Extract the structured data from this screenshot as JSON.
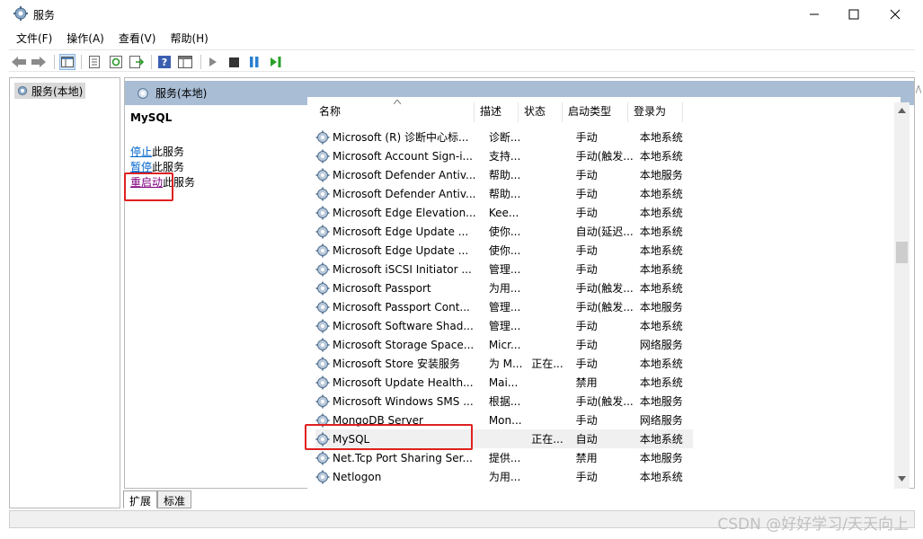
{
  "window": {
    "title": "服务"
  },
  "menu": [
    "文件(F)",
    "操作(A)",
    "查看(V)",
    "帮助(H)"
  ],
  "toolbar": {
    "icons": [
      "back-arrow-icon",
      "forward-arrow-icon",
      "show-hide-tree-icon",
      "properties-icon",
      "refresh-icon",
      "export-list-icon",
      "help-icon",
      "console-icon",
      "start-service-icon",
      "stop-service-icon",
      "pause-service-icon",
      "restart-service-icon"
    ]
  },
  "tree": {
    "node_label": "服务(本地)"
  },
  "panel": {
    "header": "服务(本地)",
    "selected_service": "MySQL",
    "actions": [
      {
        "link": "停止",
        "rest": "此服务"
      },
      {
        "link": "暂停",
        "rest": "此服务"
      },
      {
        "link": "重启动",
        "rest": "此服务"
      }
    ]
  },
  "columns": [
    "名称",
    "描述",
    "状态",
    "启动类型",
    "登录为"
  ],
  "rows": [
    {
      "name": "Microsoft (R) 诊断中心标...",
      "desc": "诊断...",
      "status": "",
      "start": "手动",
      "logon": "本地系统"
    },
    {
      "name": "Microsoft Account Sign-i...",
      "desc": "支持...",
      "status": "",
      "start": "手动(触发...",
      "logon": "本地系统"
    },
    {
      "name": "Microsoft Defender Antiv...",
      "desc": "帮助...",
      "status": "",
      "start": "手动",
      "logon": "本地服务"
    },
    {
      "name": "Microsoft Defender Antiv...",
      "desc": "帮助...",
      "status": "",
      "start": "手动",
      "logon": "本地系统"
    },
    {
      "name": "Microsoft Edge Elevation...",
      "desc": "Kee...",
      "status": "",
      "start": "手动",
      "logon": "本地系统"
    },
    {
      "name": "Microsoft Edge Update ...",
      "desc": "使你...",
      "status": "",
      "start": "自动(延迟...",
      "logon": "本地系统"
    },
    {
      "name": "Microsoft Edge Update ...",
      "desc": "使你...",
      "status": "",
      "start": "手动",
      "logon": "本地系统"
    },
    {
      "name": "Microsoft iSCSI Initiator ...",
      "desc": "管理...",
      "status": "",
      "start": "手动",
      "logon": "本地系统"
    },
    {
      "name": "Microsoft Passport",
      "desc": "为用...",
      "status": "",
      "start": "手动(触发...",
      "logon": "本地系统"
    },
    {
      "name": "Microsoft Passport Cont...",
      "desc": "管理...",
      "status": "",
      "start": "手动(触发...",
      "logon": "本地服务"
    },
    {
      "name": "Microsoft Software Shad...",
      "desc": "管理...",
      "status": "",
      "start": "手动",
      "logon": "本地系统"
    },
    {
      "name": "Microsoft Storage Space...",
      "desc": "Micr...",
      "status": "",
      "start": "手动",
      "logon": "网络服务"
    },
    {
      "name": "Microsoft Store 安装服务",
      "desc": "为 M...",
      "status": "正在...",
      "start": "手动",
      "logon": "本地系统"
    },
    {
      "name": "Microsoft Update Health...",
      "desc": "Mai...",
      "status": "",
      "start": "禁用",
      "logon": "本地系统"
    },
    {
      "name": "Microsoft Windows SMS ...",
      "desc": "根据...",
      "status": "",
      "start": "手动(触发...",
      "logon": "本地服务"
    },
    {
      "name": "MongoDB Server",
      "desc": "Mon...",
      "status": "",
      "start": "手动",
      "logon": "网络服务"
    },
    {
      "name": "MySQL",
      "desc": "",
      "status": "正在...",
      "start": "自动",
      "logon": "本地系统"
    },
    {
      "name": "Net.Tcp Port Sharing Ser...",
      "desc": "提供...",
      "status": "",
      "start": "禁用",
      "logon": "本地服务"
    },
    {
      "name": "Netlogon",
      "desc": "为用...",
      "status": "",
      "start": "手动",
      "logon": "本地系统"
    }
  ],
  "selected_row_index": 16,
  "tabs": [
    "扩展",
    "标准"
  ],
  "watermark": "CSDN @好好学习/天天向上",
  "colors": {
    "panel_header": "#a9bdd5",
    "highlight": "#e02020",
    "link": "#0066cc"
  }
}
